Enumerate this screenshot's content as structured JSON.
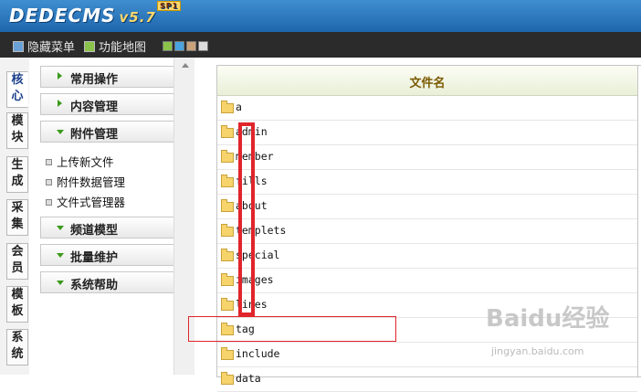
{
  "header": {
    "logo_text": "DEDECMS",
    "version": "v5.7",
    "badge": "SP1"
  },
  "toolbar": {
    "items": [
      {
        "label": "隐藏菜单"
      },
      {
        "label": "功能地图"
      }
    ],
    "swatches": [
      "#8bc34a",
      "#4aa3df",
      "#c9a27a",
      "#dddddd"
    ]
  },
  "vtabs": [
    {
      "label": "核心",
      "active": true
    },
    {
      "label": "模块"
    },
    {
      "label": "生成"
    },
    {
      "label": "采集"
    },
    {
      "label": "会员"
    },
    {
      "label": "模板"
    },
    {
      "label": "系统"
    }
  ],
  "menu": {
    "sections": [
      {
        "label": "常用操作"
      },
      {
        "label": "内容管理"
      },
      {
        "label": "附件管理"
      },
      {
        "label": "频道模型"
      },
      {
        "label": "批量维护"
      },
      {
        "label": "系统帮助"
      }
    ],
    "attachment_items": [
      {
        "label": "上传新文件"
      },
      {
        "label": "附件数据管理"
      },
      {
        "label": "文件式管理器"
      }
    ]
  },
  "file_table": {
    "header": "文件名",
    "rows": [
      {
        "name": "a"
      },
      {
        "name": "admin"
      },
      {
        "name": "member"
      },
      {
        "name": "fills"
      },
      {
        "name": "about"
      },
      {
        "name": "templets"
      },
      {
        "name": "special"
      },
      {
        "name": "images"
      },
      {
        "name": "lines"
      },
      {
        "name": "tag"
      },
      {
        "name": "include"
      },
      {
        "name": "data"
      }
    ]
  },
  "watermark": {
    "brand": "Baidu经验",
    "url": "jingyan.baidu.com"
  },
  "colors": {
    "header_blue": "#2b73b8",
    "accent_green": "#3a9a1a",
    "highlight_red": "#e0252b"
  }
}
